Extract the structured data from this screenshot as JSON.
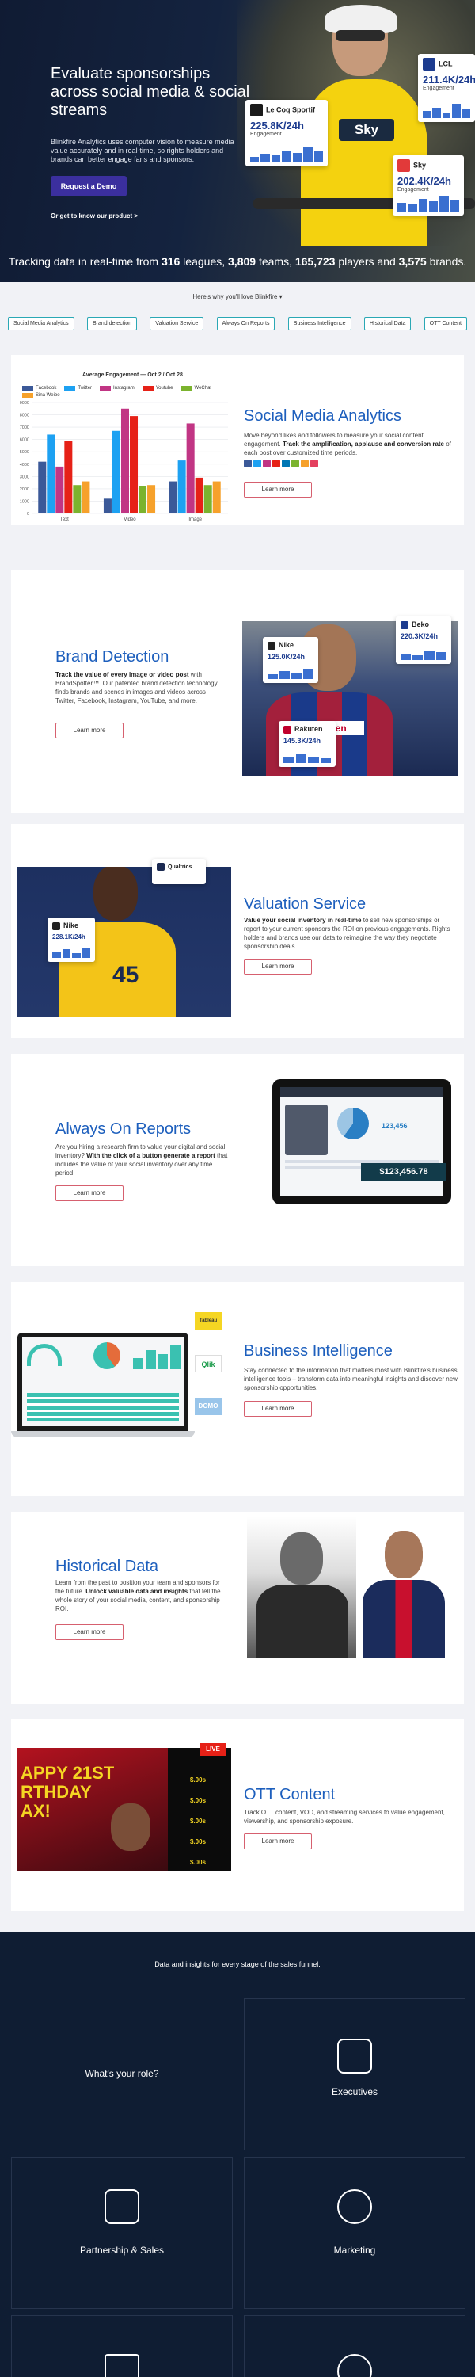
{
  "hero": {
    "title": "Evaluate sponsorships across social media & social streams",
    "lead": "Blinkfire Analytics uses computer vision to measure media value accurately and in real-time, so rights holders and brands can better engage fans and sponsors.",
    "demo_button": "Request a Demo",
    "products_link": "Or get to know our product >",
    "stats": {
      "prefix": "Tracking data in real-time from ",
      "leagues": "316",
      "leagues_label": " leagues, ",
      "teams": "3,809",
      "teams_label": " teams, ",
      "players": "165,723",
      "players_label": " players and ",
      "brands": "3,575",
      "brands_label": " brands."
    },
    "jersey_text": "Sky",
    "cards": [
      {
        "brand": "Le Coq Sportif",
        "value": "225.8K/24h",
        "label": "Engagement",
        "color": "#1d3c8f"
      },
      {
        "brand": "LCL",
        "value": "211.4K/24h",
        "label": "Engagement",
        "color": "#1d3c8f"
      },
      {
        "brand": "Sky",
        "value": "202.4K/24h",
        "label": "Engagement",
        "color": "#1d3c8f"
      }
    ]
  },
  "why_label": "Here's why you'll love Blinkfire",
  "tabs": [
    "Social Media Analytics",
    "Brand detection",
    "Valuation Service",
    "Always On Reports",
    "Business Intelligence",
    "Historical Data",
    "OTT Content"
  ],
  "sections": {
    "social": {
      "title": "Social Media Analytics",
      "desc_plain": "Move beyond likes and followers to measure your social content engagement. ",
      "desc_bold": "Track the amplification, applause and conversion rate",
      "desc_end": " of each post over customized time periods.",
      "button": "Learn more"
    },
    "brand": {
      "title": "Brand Detection",
      "desc_bold": "Track the value of every image or video post",
      "desc_plain": " with BrandSpotter™. Our patented brand detection technology finds brands and scenes in images and videos across Twitter, Facebook, Instagram, YouTube, and more.",
      "button": "Learn more",
      "cards": [
        {
          "brand": "Nike",
          "value": "125.0K/24h"
        },
        {
          "brand": "Beko",
          "value": "220.3K/24h"
        },
        {
          "brand": "Rakuten",
          "value": "145.3K/24h"
        }
      ]
    },
    "valuation": {
      "title": "Valuation Service",
      "desc_bold": "Value your social inventory in real-time",
      "desc_plain": " to sell new sponsorships or report to your current sponsors the ROI on previous engagements. Rights holders and brands use our data to reimagine the way they negotiate sponsorship deals.",
      "button": "Learn more",
      "cards": [
        {
          "brand": "Nike",
          "value": "228.1K/24h"
        },
        {
          "brand": "Qualtrics",
          "value": ""
        }
      ],
      "jersey_number": "45"
    },
    "reports": {
      "title": "Always On Reports",
      "desc_plain": "Are you hiring a research firm to value your digital and social inventory? ",
      "desc_bold": "With the click of a button generate a report",
      "desc_end": " that includes the value of your social inventory over any time period.",
      "button": "Learn more",
      "tablet_value": "$123,456.78",
      "tablet_inner_value": "123,456"
    },
    "bi": {
      "title": "Business Intelligence",
      "desc": "Stay connected to the information that matters most with Blinkfire's business intelligence tools – transform data into meaningful insights and discover new sponsorship opportunities.",
      "button": "Learn more",
      "logos": [
        "Tableau",
        "Qlik",
        "DOMO"
      ]
    },
    "historical": {
      "title": "Historical Data",
      "desc_plain": "Learn from the past to position your team and sponsors for the future. ",
      "desc_bold": "Unlock valuable data and insights",
      "desc_end": " that tell the whole story of your social media, content, and sponsorship ROI.",
      "button": "Learn more"
    },
    "ott": {
      "title": "OTT Content",
      "desc": "Track OTT content, VOD, and streaming services to value engagement, viewership, and sponsorship exposure.",
      "button": "Learn more",
      "live_label": "LIVE",
      "screen_text": "APPY 21ST RTHDAY AX!",
      "rows": [
        "$.00s",
        "$.00s",
        "$.00s",
        "$.00s",
        "$.00s"
      ]
    }
  },
  "chart_data": {
    "type": "bar",
    "title": "Average Engagement — Oct 2 / Oct 28",
    "categories": [
      "Text",
      "Video",
      "Image"
    ],
    "ylim": [
      0,
      9000
    ],
    "yticks": [
      0,
      1000,
      2000,
      3000,
      4000,
      5000,
      6000,
      7000,
      8000,
      9000
    ],
    "series": [
      {
        "name": "Facebook",
        "color": "#3b5998",
        "values": [
          4200,
          1200,
          2600
        ]
      },
      {
        "name": "Twitter",
        "color": "#1da1f2",
        "values": [
          6400,
          6700,
          4300
        ]
      },
      {
        "name": "Instagram",
        "color": "#c13584",
        "values": [
          3800,
          8500,
          7300
        ]
      },
      {
        "name": "Youtube",
        "color": "#e62117",
        "values": [
          5900,
          7900,
          2900
        ]
      },
      {
        "name": "WeChat",
        "color": "#7bb32e",
        "values": [
          2300,
          2200,
          2300
        ]
      },
      {
        "name": "Sina Weibo",
        "color": "#f6a12b",
        "values": [
          2600,
          2300,
          2600
        ]
      }
    ]
  },
  "social_icon_colors": [
    "#3b5998",
    "#1da1f2",
    "#c13584",
    "#e62117",
    "#0077b5",
    "#7bb32e",
    "#f6a12b",
    "#e4405f"
  ],
  "roles": {
    "title": "Data and insights for every stage of the sales funnel.",
    "question": "What's your role?",
    "items": [
      "Executives",
      "Partnership & Sales",
      "Marketing"
    ]
  }
}
